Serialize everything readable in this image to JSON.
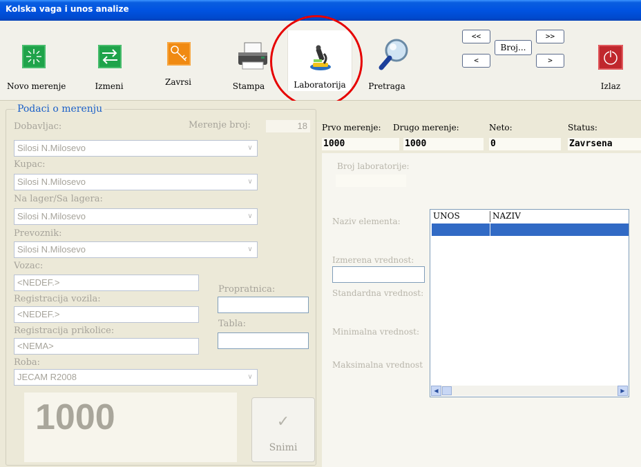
{
  "window": {
    "title": "Kolska vaga i unos analize"
  },
  "toolbar": {
    "new_label": "Novo merenje",
    "edit_label": "Izmeni",
    "finish_label": "Zavrsi",
    "print_label": "Stampa",
    "lab_label": "Laboratorija",
    "search_label": "Pretraga",
    "exit_label": "Izlaz",
    "nav_first": "<<",
    "nav_prev": "<",
    "nav_number": "Broj...",
    "nav_last": ">>",
    "nav_next": ">"
  },
  "form": {
    "group_title": "Podaci o merenju",
    "supplier_label": "Dobavljac:",
    "measurement_no_label": "Merenje broj:",
    "measurement_no": "18",
    "supplier_value": "Silosi N.Milosevo",
    "buyer_label": "Kupac:",
    "buyer_value": "Silosi N.Milosevo",
    "storage_label": "Na lager/Sa lagera:",
    "storage_value": "Silosi N.Milosevo",
    "carrier_label": "Prevoznik:",
    "carrier_value": "Silosi N.Milosevo",
    "driver_label": "Vozac:",
    "driver_value": "<NEDEF.>",
    "delivery_note_label": "Propratnica:",
    "delivery_note_value": "",
    "vehicle_reg_label": "Registracija vozila:",
    "vehicle_reg_value": "<NEDEF.>",
    "plate_label": "Tabla:",
    "plate_value": "",
    "trailer_reg_label": "Registracija prikolice:",
    "trailer_reg_value": "<NEMA>",
    "goods_label": "Roba:",
    "goods_value": "JECAM R2008",
    "weight_display": "1000",
    "save_label": "Snimi"
  },
  "summary": {
    "first_label": "Prvo merenje:",
    "first_value": "1000",
    "second_label": "Drugo merenje:",
    "second_value": "1000",
    "net_label": "Neto:",
    "net_value": "0",
    "status_label": "Status:",
    "status_value": "Zavrsena"
  },
  "lab": {
    "lab_number_label": "Broj laboratorije:",
    "lab_number_value": "",
    "element_name_label": "Naziv elementa:",
    "measured_label": "Izmerena vrednost:",
    "measured_value": "",
    "standard_label": "Standardna vrednost:",
    "min_label": "Minimalna vrednost:",
    "max_label": "Maksimalna vrednost",
    "grid_columns": [
      "UNOS",
      "NAZIV"
    ]
  },
  "colors": {
    "title_bar": "#0053e1",
    "accent_red": "#e60000",
    "selection": "#316ac5",
    "group_title": "#1a5fc8"
  }
}
